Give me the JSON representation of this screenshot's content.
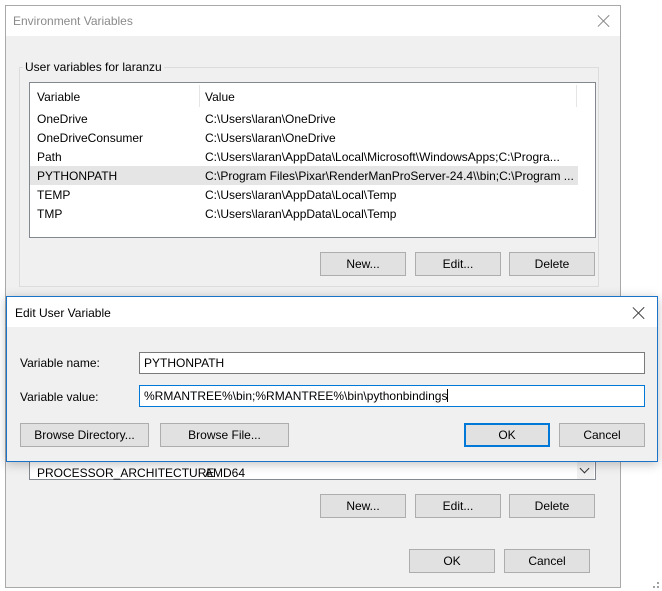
{
  "env_window": {
    "title": "Environment Variables",
    "user_group_label": "User variables for laranzu",
    "columns": [
      "Variable",
      "Value"
    ],
    "user_variables": [
      {
        "name": "OneDrive",
        "value": "C:\\Users\\laran\\OneDrive"
      },
      {
        "name": "OneDriveConsumer",
        "value": "C:\\Users\\laran\\OneDrive"
      },
      {
        "name": "Path",
        "value": "C:\\Users\\laran\\AppData\\Local\\Microsoft\\WindowsApps;C:\\Progra..."
      },
      {
        "name": "PYTHONPATH",
        "value": "C:\\Program Files\\Pixar\\RenderManProServer-24.4\\\\bin;C:\\Program ..."
      },
      {
        "name": "TEMP",
        "value": "C:\\Users\\laran\\AppData\\Local\\Temp"
      },
      {
        "name": "TMP",
        "value": "C:\\Users\\laran\\AppData\\Local\\Temp"
      }
    ],
    "selected_user_variable": "PYTHONPATH",
    "user_buttons": {
      "new": "New...",
      "edit": "Edit...",
      "delete": "Delete"
    },
    "system_visible_row": {
      "name": "PROCESSOR_ARCHITECTURE",
      "value": "AMD64"
    },
    "system_buttons": {
      "new": "New...",
      "edit": "Edit...",
      "delete": "Delete"
    },
    "ok": "OK",
    "cancel": "Cancel"
  },
  "edit_dialog": {
    "title": "Edit User Variable",
    "name_label": "Variable name:",
    "name_value": "PYTHONPATH",
    "value_label": "Variable value:",
    "value_value": "%RMANTREE%\\bin;%RMANTREE%\\bin\\pythonbindings",
    "browse_directory": "Browse Directory...",
    "browse_file": "Browse File...",
    "ok": "OK",
    "cancel": "Cancel"
  },
  "colors": {
    "accent": "#0078d7",
    "selection": "#e5e5e5",
    "window_bg": "#f0f0f0"
  }
}
